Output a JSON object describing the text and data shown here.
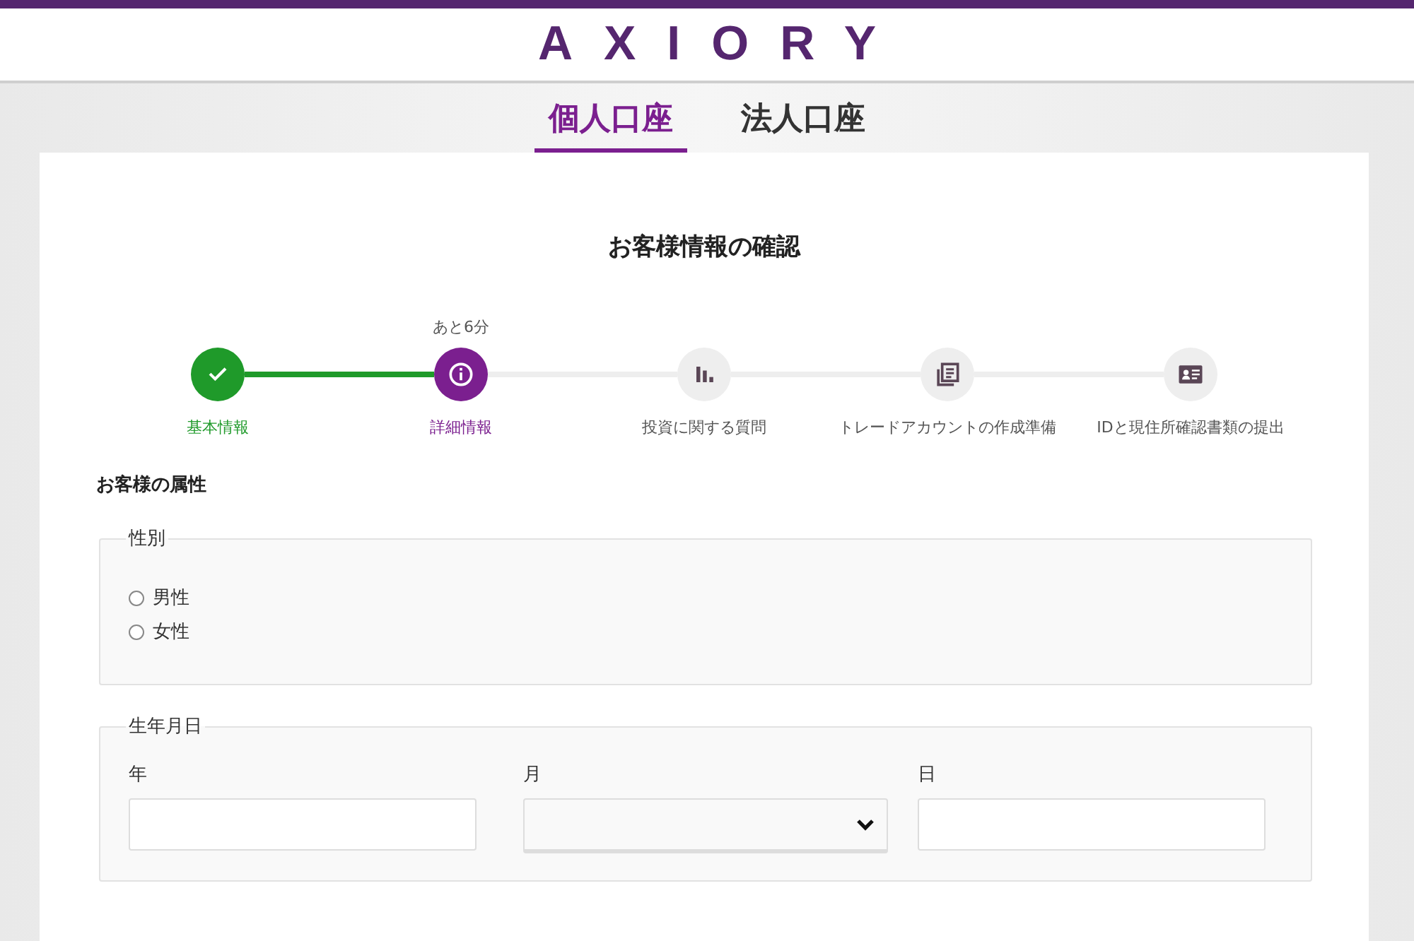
{
  "logo": "AXIORY",
  "account_tabs": [
    {
      "label": "個人口座",
      "selected": true
    },
    {
      "label": "法人口座",
      "selected": false
    }
  ],
  "title": "お客様情報の確認",
  "steps": [
    {
      "label": "基本情報",
      "completed": true,
      "selected": false
    },
    {
      "label": "詳細情報",
      "completed": false,
      "selected": true,
      "hint": "あと6分"
    },
    {
      "label": "投資に関する質問",
      "completed": false,
      "selected": false
    },
    {
      "label": "トレードアカウントの作成準備",
      "completed": false,
      "selected": false
    },
    {
      "label": "IDと現住所確認書類の提出",
      "completed": false,
      "selected": false
    }
  ],
  "section_title": "お客様の属性",
  "gender": {
    "legend": "性別",
    "options": [
      {
        "label": "男性",
        "selected": false
      },
      {
        "label": "女性",
        "selected": false
      }
    ]
  },
  "birthdate": {
    "legend": "生年月日",
    "fields": [
      {
        "label": "年",
        "kind": "text"
      },
      {
        "label": "月",
        "kind": "select"
      },
      {
        "label": "日",
        "kind": "text"
      }
    ]
  }
}
